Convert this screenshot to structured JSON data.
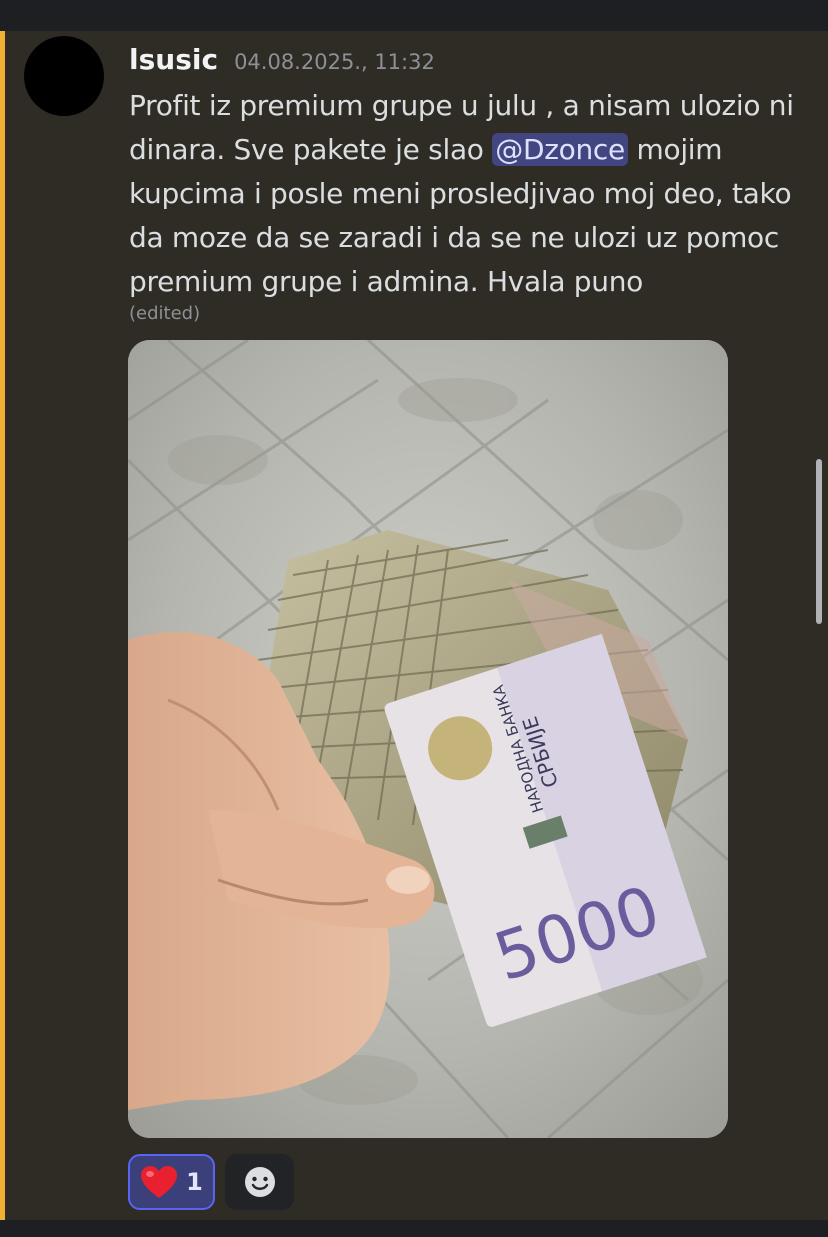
{
  "message": {
    "username": "lsusic",
    "timestamp": "04.08.2025., 11:32",
    "text_before_mention": "Profit iz premium grupe u julu , a nisam ulozio ni dinara. Sve pakete je slao ",
    "mention": "@Dzonce",
    "text_after_mention": " mojim kupcima i posle meni prosledjivao moj deo, tako da moze da se zaradi i da se ne ulozi uz pomoc premium grupe i admina. Hvala puno",
    "edited_label": "(edited)"
  },
  "attachment": {
    "banknote_bank_line1": "НАРОДНА БАНКА",
    "banknote_bank_line2": "СРБИЈЕ",
    "banknote_value": "5000"
  },
  "reactions": [
    {
      "emoji": "heart-icon",
      "count": "1"
    },
    {
      "emoji": "add-reaction-icon"
    }
  ],
  "colors": {
    "message_bg": "#2f2c25",
    "highlight_bar": "#f0b232",
    "mention_bg": "#5865f2",
    "reaction_active_border": "#5865f2"
  }
}
